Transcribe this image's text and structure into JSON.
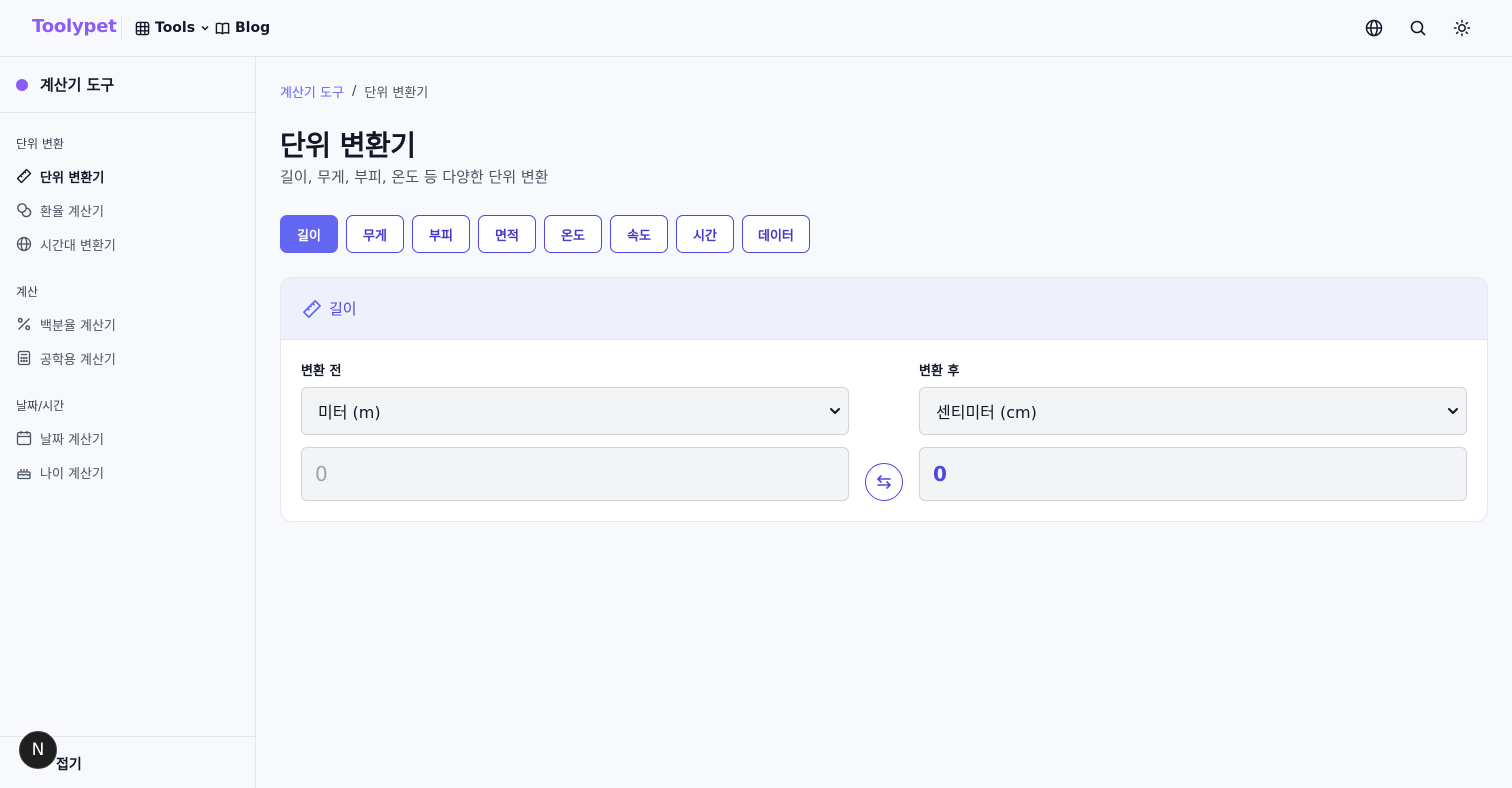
{
  "header": {
    "brand": "Toolypet",
    "nav": {
      "tools": "Tools",
      "blog": "Blog"
    },
    "icons": [
      "grid-icon",
      "chevron-down-icon",
      "book-icon",
      "globe-icon",
      "search-icon",
      "sun-icon"
    ]
  },
  "sidebar": {
    "title": "계산기 도구",
    "accent": "#8b5cf6",
    "sections": {
      "unit": "단위 변환",
      "calc": "계산",
      "date": "날짜/시간"
    },
    "items": {
      "unit_converter": "단위 변환기",
      "currency": "환율 계산기",
      "timezone": "시간대 변환기",
      "percent": "백분율 계산기",
      "scientific": "공학용 계산기",
      "date_calc": "날짜 계산기",
      "age_calc": "나이 계산기"
    },
    "collapse": "접기",
    "badge": "N"
  },
  "main": {
    "breadcrumb": {
      "parent": "계산기 도구",
      "separator": "/",
      "current": "단위 변환기"
    },
    "title": "단위 변환기",
    "subtitle": "길이, 무게, 부피, 온도 등 다양한 단위 변환",
    "tabs": [
      "길이",
      "무게",
      "부피",
      "면적",
      "온도",
      "속도",
      "시간",
      "데이터"
    ],
    "active_tab": "길이",
    "accent": "#6366f1"
  },
  "converter": {
    "header_title": "길이",
    "from_label": "변환 전",
    "to_label": "변환 후",
    "from_unit": "미터 (m)",
    "to_unit": "센티미터 (cm)",
    "from_placeholder": "0",
    "to_value": "0"
  }
}
